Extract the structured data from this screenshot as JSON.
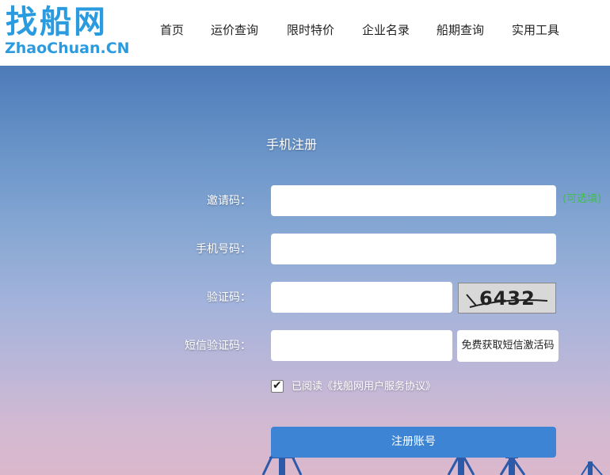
{
  "brand": {
    "logo_cn": "找船网",
    "logo_en": "ZhaoChuan.CN"
  },
  "nav": {
    "items": [
      {
        "label": "首页"
      },
      {
        "label": "运价查询"
      },
      {
        "label": "限时特价"
      },
      {
        "label": "企业名录"
      },
      {
        "label": "船期查询"
      },
      {
        "label": "实用工具"
      }
    ]
  },
  "form": {
    "title": "手机注册",
    "invite_label": "邀请码：",
    "invite_value": "",
    "invite_note": "(可选填)",
    "phone_label": "手机号码：",
    "phone_value": "",
    "captcha_label": "验证码：",
    "captcha_value": "",
    "captcha_image_text": "6432",
    "sms_label": "短信验证码：",
    "sms_value": "",
    "sms_button": "免费获取短信激活码",
    "agree_checked": true,
    "agree_text": "已阅读《找船网用户服务协议》",
    "submit_label": "注册账号"
  },
  "colors": {
    "brand": "#2b9be0",
    "submit": "#3d84d4",
    "optional_note": "#3fc04a"
  }
}
